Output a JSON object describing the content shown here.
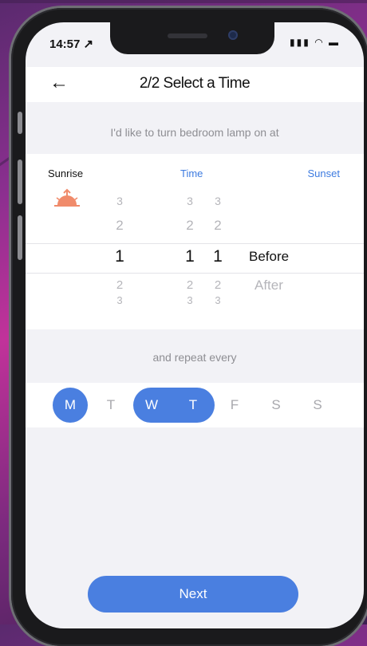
{
  "status_bar": {
    "time": "14:57 ↗",
    "icons": "▮▮▮ ◠ ▬"
  },
  "header": {
    "back_glyph": "←",
    "title": "2/2 Select a Time"
  },
  "prompt_text": "I'd like to turn bedroom lamp on at",
  "picker": {
    "labels": {
      "sunrise": "Sunrise",
      "time": "Time",
      "sunset": "Sunset"
    },
    "columns": [
      {
        "name": "offset",
        "values": [
          "3",
          "2",
          "1",
          "2",
          "3"
        ],
        "selected": "1"
      },
      {
        "name": "hours",
        "values": [
          "3",
          "2",
          "1",
          "2",
          "3"
        ],
        "selected": "1"
      },
      {
        "name": "minutes",
        "values": [
          "3",
          "2",
          "1",
          "2",
          "3"
        ],
        "selected": "1"
      }
    ],
    "mode": {
      "selected": "Before",
      "other": "After"
    }
  },
  "repeat_text": "and repeat every",
  "days": [
    {
      "label": "M",
      "selected": true
    },
    {
      "label": "T",
      "selected": false
    },
    {
      "label": "W",
      "selected": true
    },
    {
      "label": "T",
      "selected": true
    },
    {
      "label": "F",
      "selected": false
    },
    {
      "label": "S",
      "selected": false
    },
    {
      "label": "S",
      "selected": false
    }
  ],
  "next_label": "Next",
  "colors": {
    "accent": "#4a7fe0",
    "sunrise_icon": "#f08b6b"
  }
}
